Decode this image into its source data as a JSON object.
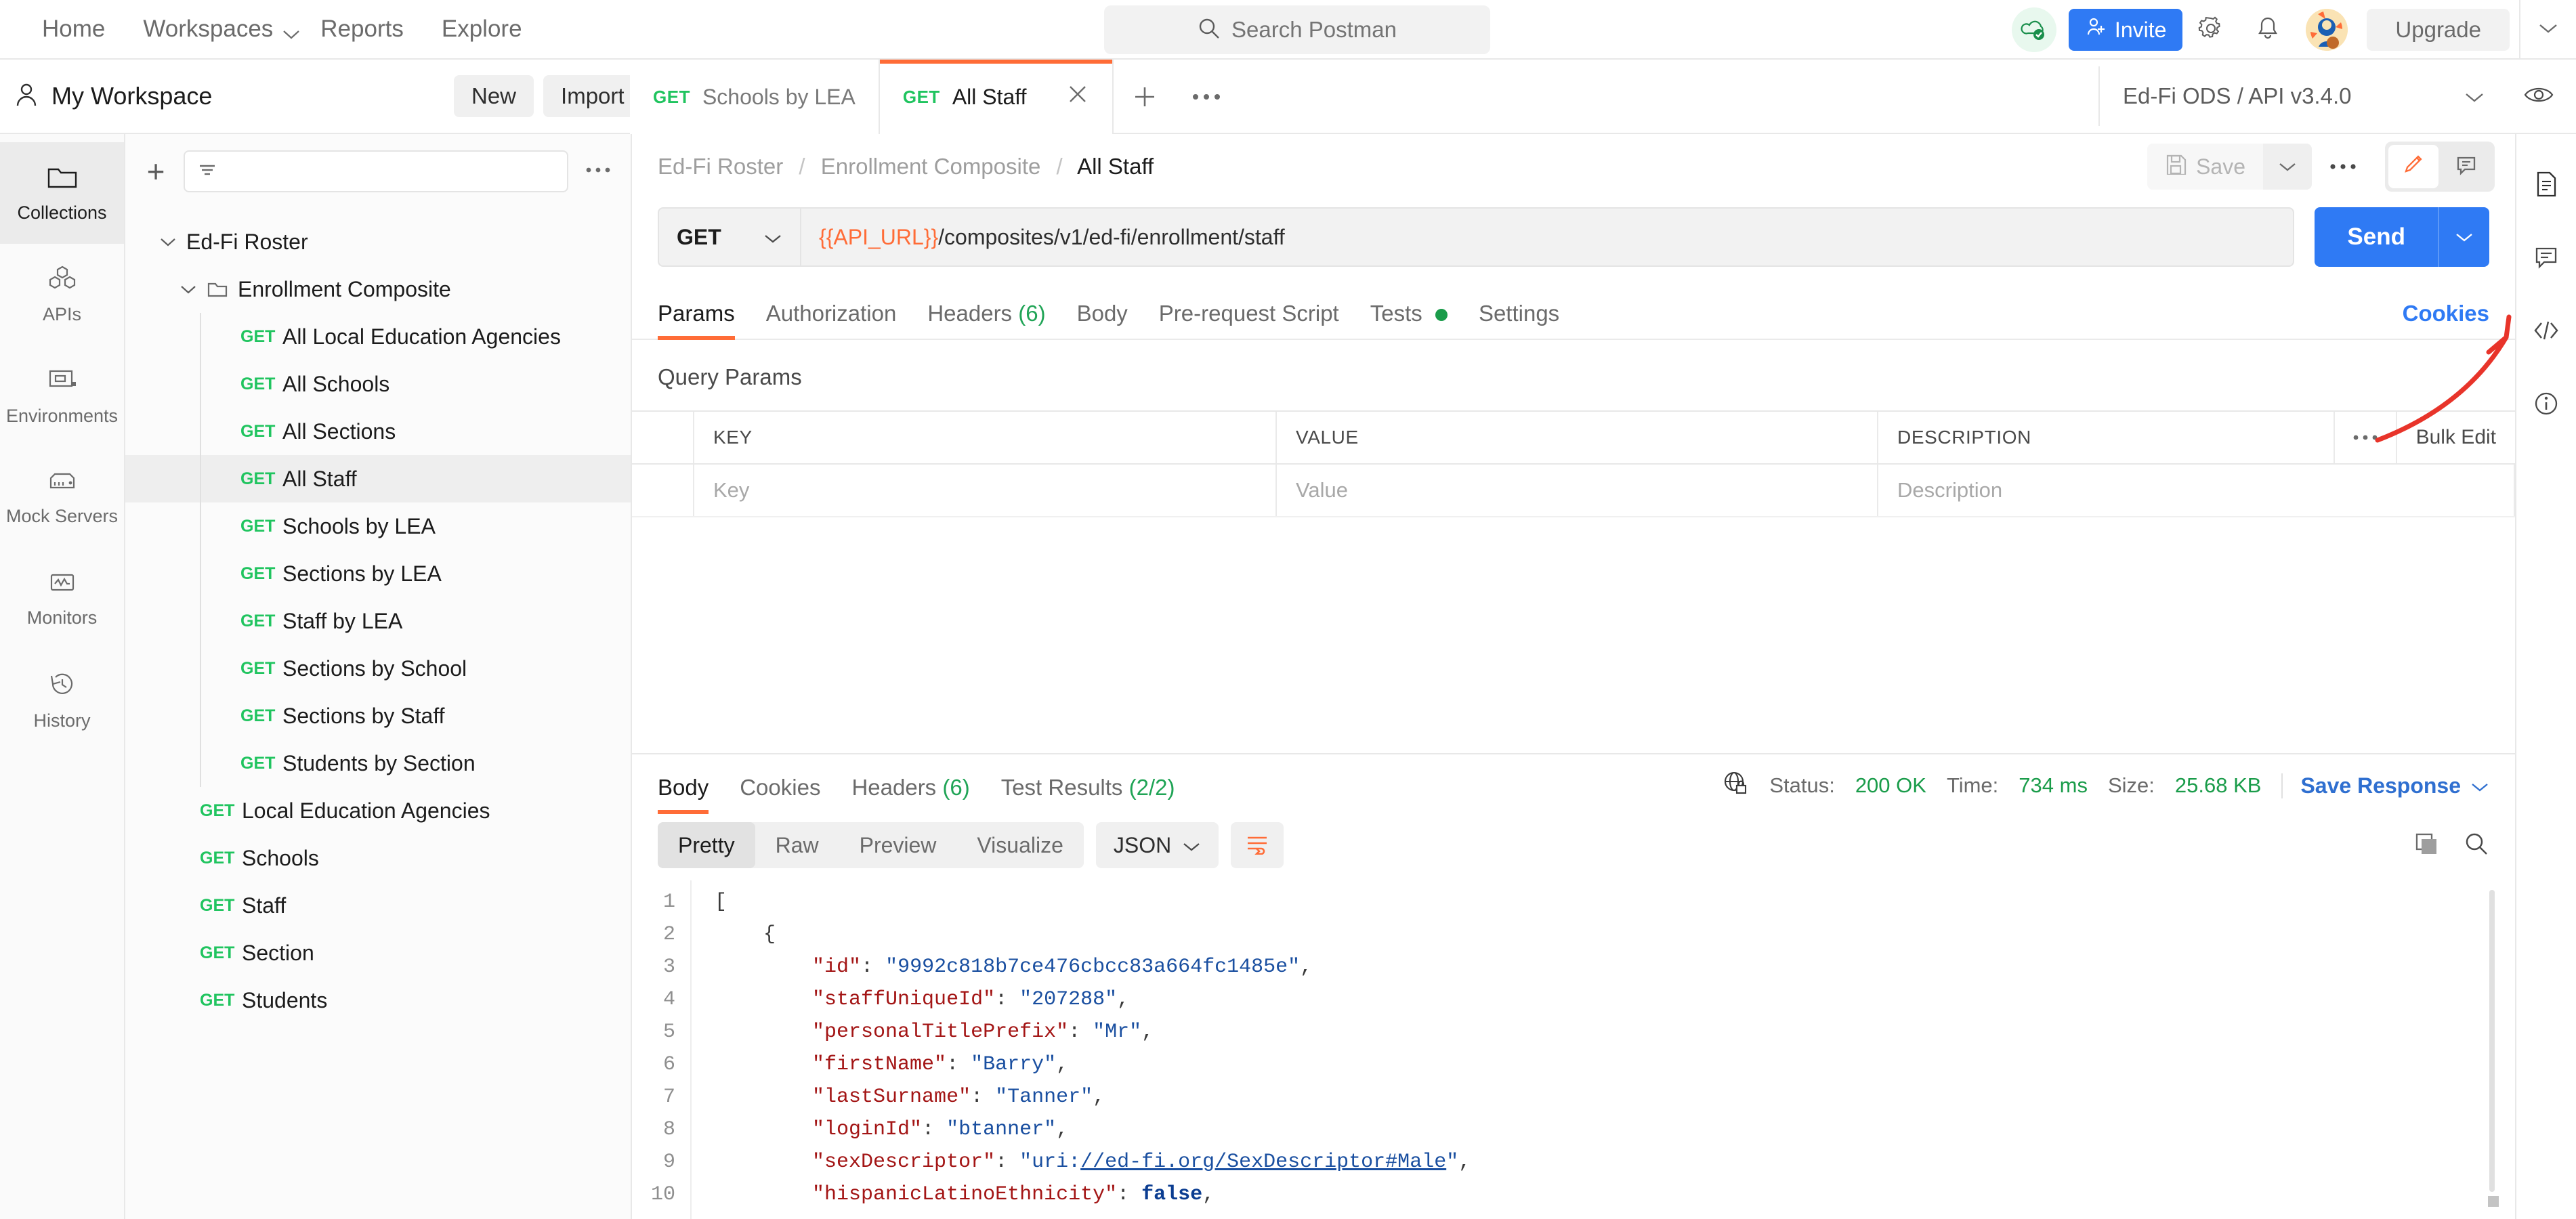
{
  "topnav": {
    "items": [
      {
        "label": "Home",
        "caret": false
      },
      {
        "label": "Workspaces",
        "caret": true
      },
      {
        "label": "Reports",
        "caret": false
      },
      {
        "label": "Explore",
        "caret": false
      }
    ],
    "search_placeholder": "Search Postman",
    "invite_label": "Invite",
    "upgrade_label": "Upgrade"
  },
  "workspace": {
    "title": "My Workspace",
    "new_label": "New",
    "import_label": "Import",
    "environment": "Ed-Fi ODS / API v3.4.0"
  },
  "tabs": [
    {
      "verb": "GET",
      "label": "Schools by LEA",
      "active": false
    },
    {
      "verb": "GET",
      "label": "All Staff",
      "active": true
    }
  ],
  "rail": {
    "items": [
      {
        "label": "Collections",
        "icon": "collections-icon",
        "active": true
      },
      {
        "label": "APIs",
        "icon": "apis-icon",
        "active": false
      },
      {
        "label": "Environments",
        "icon": "environments-icon",
        "active": false
      },
      {
        "label": "Mock Servers",
        "icon": "mock-servers-icon",
        "active": false
      },
      {
        "label": "Monitors",
        "icon": "monitors-icon",
        "active": false
      },
      {
        "label": "History",
        "icon": "history-icon",
        "active": false
      }
    ]
  },
  "sidebar": {
    "filter_placeholder": "",
    "tree": [
      {
        "level": 0,
        "type": "collection",
        "label": "Ed-Fi Roster",
        "expanded": true
      },
      {
        "level": 1,
        "type": "folder",
        "label": "Enrollment Composite",
        "expanded": true
      },
      {
        "level": 2,
        "type": "request",
        "verb": "GET",
        "label": "All Local Education Agencies"
      },
      {
        "level": 2,
        "type": "request",
        "verb": "GET",
        "label": "All Schools"
      },
      {
        "level": 2,
        "type": "request",
        "verb": "GET",
        "label": "All Sections"
      },
      {
        "level": 2,
        "type": "request",
        "verb": "GET",
        "label": "All Staff",
        "selected": true
      },
      {
        "level": 2,
        "type": "request",
        "verb": "GET",
        "label": "Schools by LEA"
      },
      {
        "level": 2,
        "type": "request",
        "verb": "GET",
        "label": "Sections by LEA"
      },
      {
        "level": 2,
        "type": "request",
        "verb": "GET",
        "label": "Staff by LEA"
      },
      {
        "level": 2,
        "type": "request",
        "verb": "GET",
        "label": "Sections by School"
      },
      {
        "level": 2,
        "type": "request",
        "verb": "GET",
        "label": "Sections by Staff"
      },
      {
        "level": 2,
        "type": "request",
        "verb": "GET",
        "label": "Students by Section"
      },
      {
        "level": 1,
        "type": "request",
        "verb": "GET",
        "label": "Local Education Agencies"
      },
      {
        "level": 1,
        "type": "request",
        "verb": "GET",
        "label": "Schools"
      },
      {
        "level": 1,
        "type": "request",
        "verb": "GET",
        "label": "Staff"
      },
      {
        "level": 1,
        "type": "request",
        "verb": "GET",
        "label": "Section"
      },
      {
        "level": 1,
        "type": "request",
        "verb": "GET",
        "label": "Students"
      }
    ]
  },
  "request": {
    "breadcrumb": {
      "c1": "Ed-Fi Roster",
      "c2": "Enrollment Composite",
      "current": "All Staff"
    },
    "save_label": "Save",
    "method": "GET",
    "url_variable": "{{API_URL}}",
    "url_path": "/composites/v1/ed-fi/enrollment/staff",
    "send_label": "Send",
    "tabs": [
      {
        "label": "Params",
        "active": true
      },
      {
        "label": "Authorization",
        "active": false
      },
      {
        "label": "Headers",
        "count": "(6)",
        "active": false
      },
      {
        "label": "Body",
        "active": false
      },
      {
        "label": "Pre-request Script",
        "active": false
      },
      {
        "label": "Tests",
        "dot": true,
        "active": false
      },
      {
        "label": "Settings",
        "active": false
      }
    ],
    "cookies_link": "Cookies",
    "query_params_title": "Query Params",
    "table": {
      "headers": {
        "key": "KEY",
        "value": "VALUE",
        "description": "DESCRIPTION"
      },
      "bulk_edit": "Bulk Edit",
      "rows": [
        {
          "key_placeholder": "Key",
          "value_placeholder": "Value",
          "description_placeholder": "Description"
        }
      ]
    }
  },
  "response": {
    "tabs": [
      {
        "label": "Body",
        "active": true
      },
      {
        "label": "Cookies",
        "active": false
      },
      {
        "label": "Headers",
        "count": "(6)",
        "active": false
      },
      {
        "label": "Test Results",
        "count": "(2/2)",
        "active": false
      }
    ],
    "status_label": "Status:",
    "status_value": "200 OK",
    "time_label": "Time:",
    "time_value": "734 ms",
    "size_label": "Size:",
    "size_value": "25.68 KB",
    "save_response": "Save Response",
    "view_modes": [
      {
        "label": "Pretty",
        "active": true
      },
      {
        "label": "Raw",
        "active": false
      },
      {
        "label": "Preview",
        "active": false
      },
      {
        "label": "Visualize",
        "active": false
      }
    ],
    "format": "JSON",
    "line_numbers": [
      "1",
      "2",
      "3",
      "4",
      "5",
      "6",
      "7",
      "8",
      "9",
      "10"
    ],
    "body_lines": [
      {
        "indent": 0,
        "parts": [
          {
            "t": "[",
            "c": "p"
          }
        ]
      },
      {
        "indent": 1,
        "parts": [
          {
            "t": "{",
            "c": "p"
          }
        ]
      },
      {
        "indent": 2,
        "parts": [
          {
            "t": "\"id\"",
            "c": "k"
          },
          {
            "t": ": ",
            "c": "p"
          },
          {
            "t": "\"9992c818b7ce476cbcc83a664fc1485e\"",
            "c": "s"
          },
          {
            "t": ",",
            "c": "p"
          }
        ]
      },
      {
        "indent": 2,
        "parts": [
          {
            "t": "\"staffUniqueId\"",
            "c": "k"
          },
          {
            "t": ": ",
            "c": "p"
          },
          {
            "t": "\"207288\"",
            "c": "s"
          },
          {
            "t": ",",
            "c": "p"
          }
        ]
      },
      {
        "indent": 2,
        "parts": [
          {
            "t": "\"personalTitlePrefix\"",
            "c": "k"
          },
          {
            "t": ": ",
            "c": "p"
          },
          {
            "t": "\"Mr\"",
            "c": "s"
          },
          {
            "t": ",",
            "c": "p"
          }
        ]
      },
      {
        "indent": 2,
        "parts": [
          {
            "t": "\"firstName\"",
            "c": "k"
          },
          {
            "t": ": ",
            "c": "p"
          },
          {
            "t": "\"Barry\"",
            "c": "s"
          },
          {
            "t": ",",
            "c": "p"
          }
        ]
      },
      {
        "indent": 2,
        "parts": [
          {
            "t": "\"lastSurname\"",
            "c": "k"
          },
          {
            "t": ": ",
            "c": "p"
          },
          {
            "t": "\"Tanner\"",
            "c": "s"
          },
          {
            "t": ",",
            "c": "p"
          }
        ]
      },
      {
        "indent": 2,
        "parts": [
          {
            "t": "\"loginId\"",
            "c": "k"
          },
          {
            "t": ": ",
            "c": "p"
          },
          {
            "t": "\"btanner\"",
            "c": "s"
          },
          {
            "t": ",",
            "c": "p"
          }
        ]
      },
      {
        "indent": 2,
        "parts": [
          {
            "t": "\"sexDescriptor\"",
            "c": "k"
          },
          {
            "t": ": ",
            "c": "p"
          },
          {
            "t": "\"uri:",
            "c": "s"
          },
          {
            "t": "//ed-fi.org/SexDescriptor#Male",
            "c": "u"
          },
          {
            "t": "\"",
            "c": "s"
          },
          {
            "t": ",",
            "c": "p"
          }
        ]
      },
      {
        "indent": 2,
        "parts": [
          {
            "t": "\"hispanicLatinoEthnicity\"",
            "c": "k"
          },
          {
            "t": ": ",
            "c": "p"
          },
          {
            "t": "false",
            "c": "b"
          },
          {
            "t": ",",
            "c": "p"
          }
        ]
      }
    ]
  },
  "colors": {
    "accent_orange": "#ff6c37",
    "blue": "#2f7af4",
    "green": "#20c45f",
    "annotation_red": "#e8342a"
  }
}
